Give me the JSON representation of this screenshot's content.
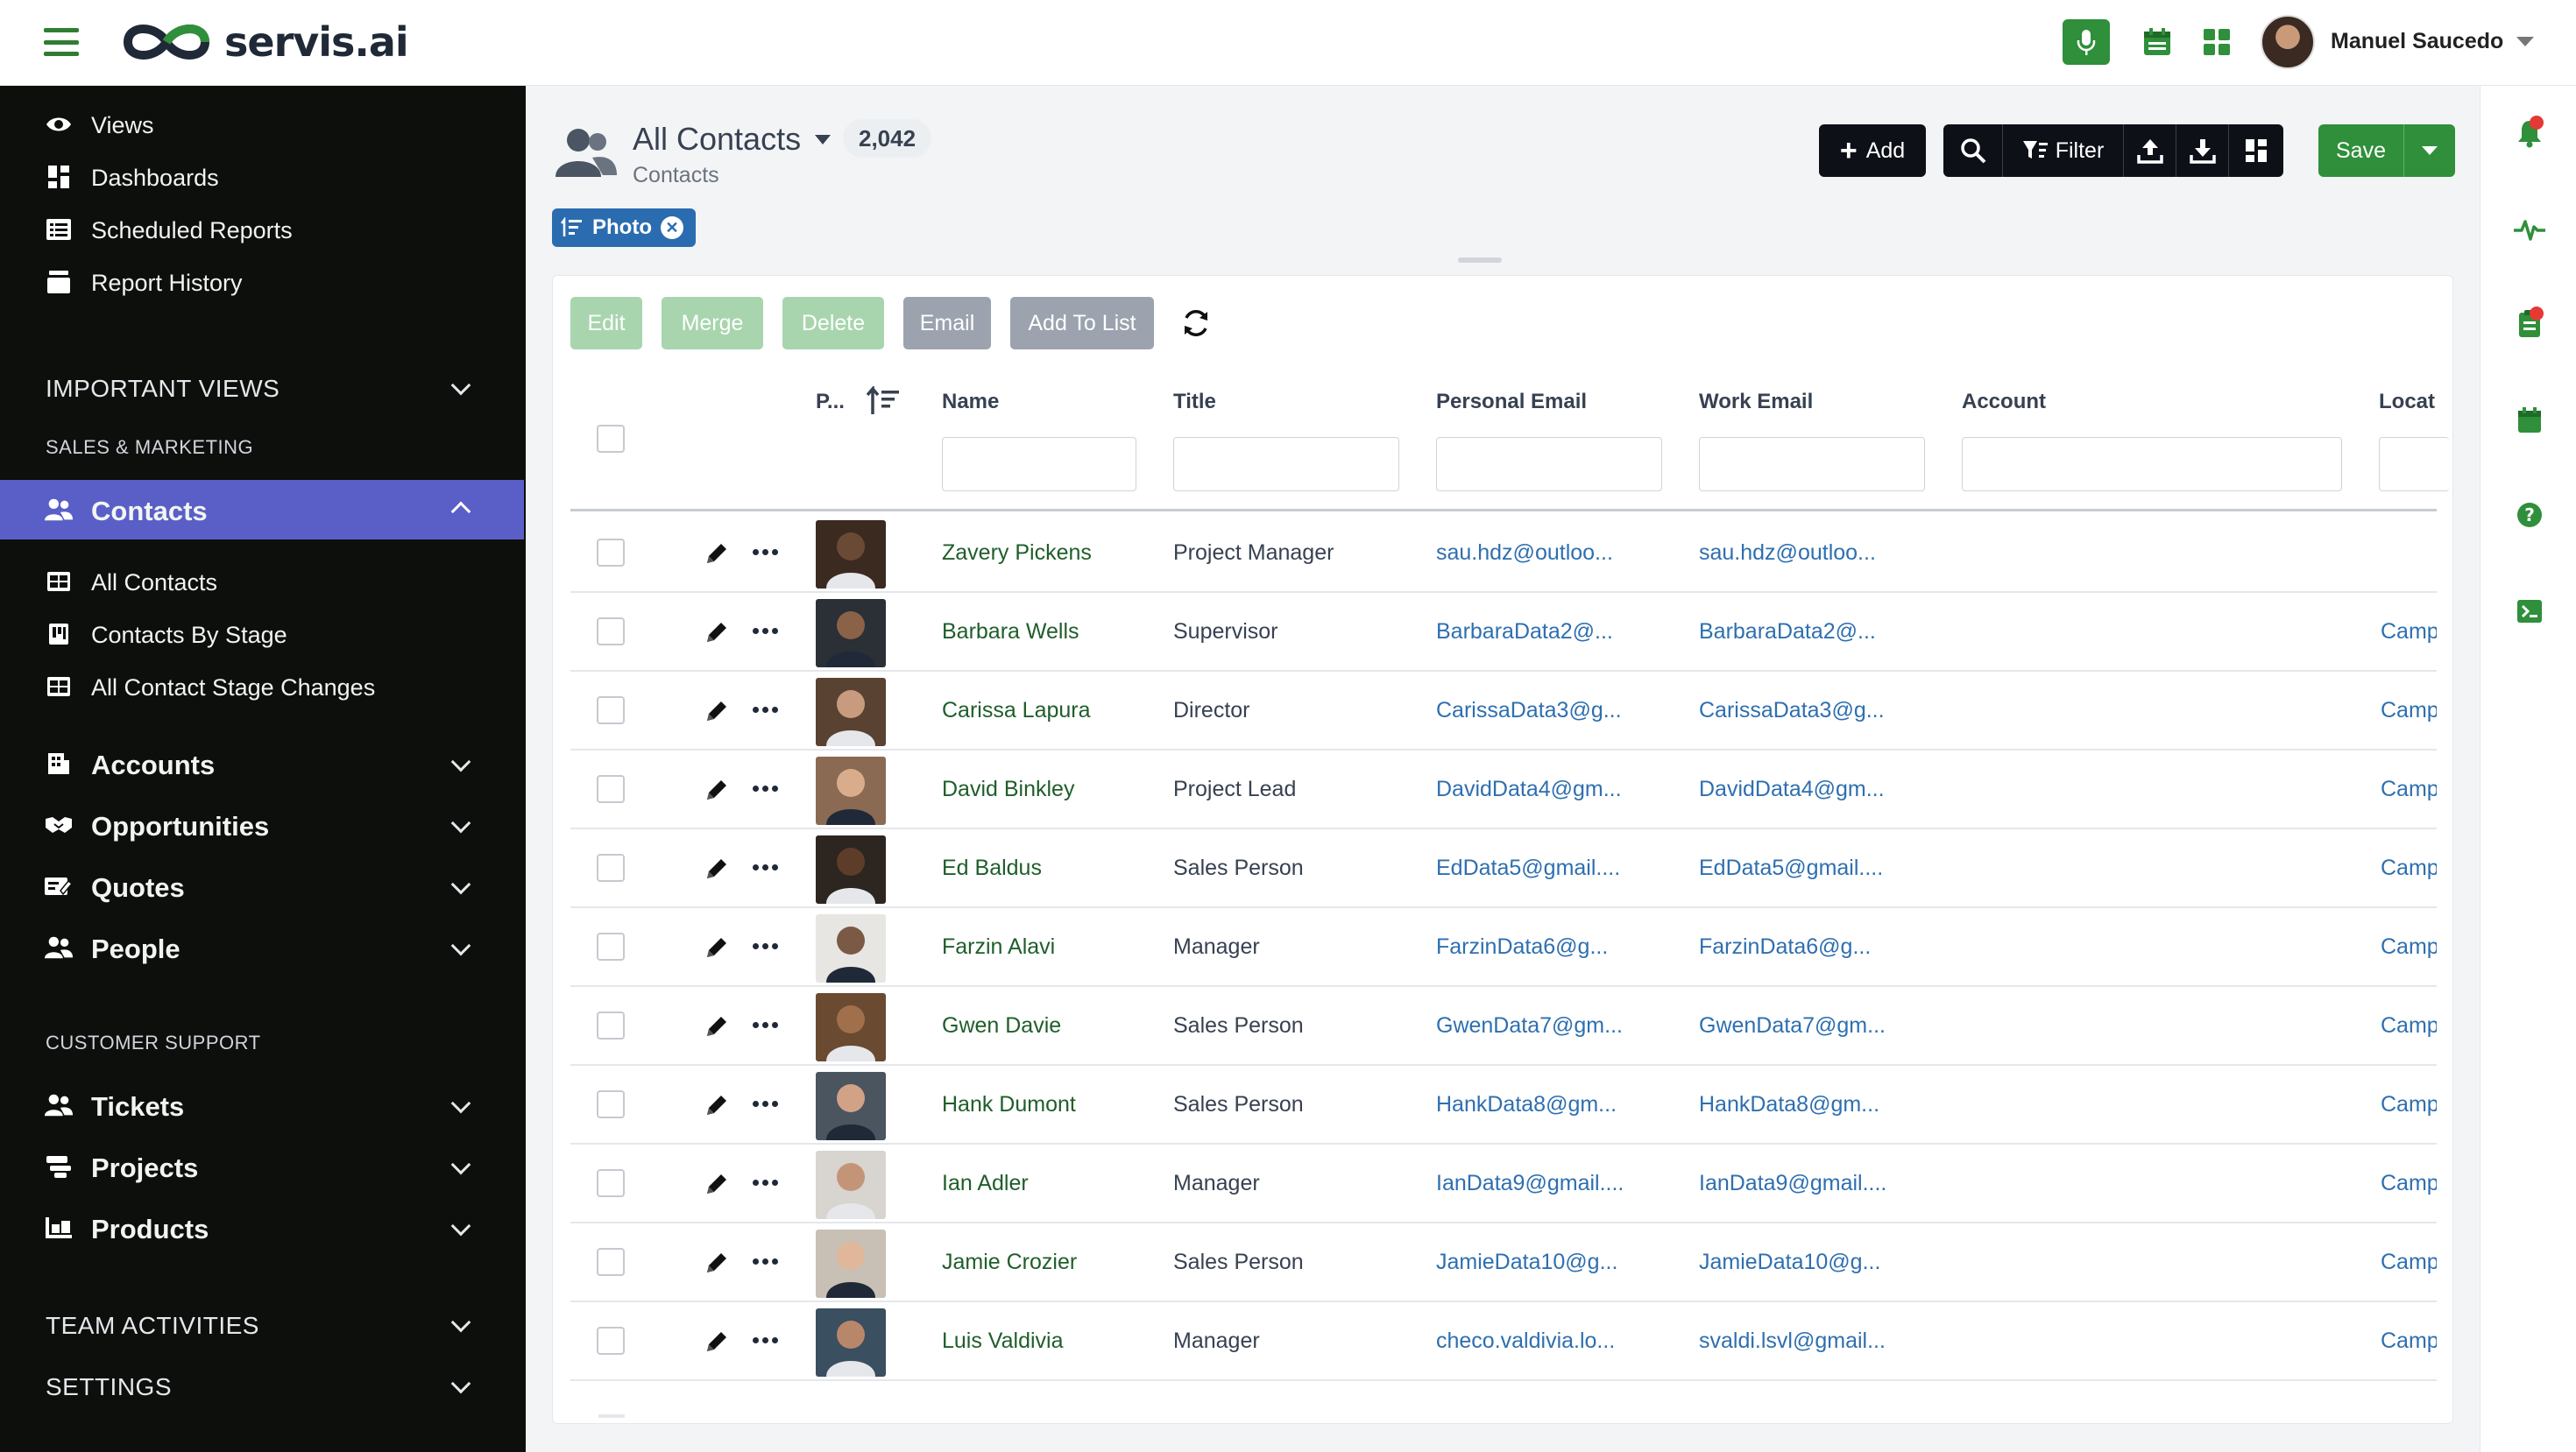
{
  "brand": {
    "name": "servis.ai"
  },
  "user": {
    "name": "Manuel Saucedo"
  },
  "sidebar": {
    "top_items": [
      {
        "label": "Views",
        "icon": "eye-icon"
      },
      {
        "label": "Dashboards",
        "icon": "dashboard-icon"
      },
      {
        "label": "Scheduled Reports",
        "icon": "report-list-icon"
      },
      {
        "label": "Report History",
        "icon": "archive-icon"
      }
    ],
    "important_views": "IMPORTANT VIEWS",
    "sales_marketing": "SALES & MARKETING",
    "contacts": "Contacts",
    "contacts_children": [
      "All Contacts",
      "Contacts By Stage",
      "All Contact Stage Changes"
    ],
    "sales_items": [
      "Accounts",
      "Opportunities",
      "Quotes",
      "People"
    ],
    "customer_support": "CUSTOMER SUPPORT",
    "support_items": [
      "Tickets",
      "Projects",
      "Products"
    ],
    "team_activities": "TEAM ACTIVITIES",
    "settings": "SETTINGS"
  },
  "header": {
    "title": "All Contacts",
    "count": "2,042",
    "subtitle": "Contacts",
    "chip": "Photo",
    "add_label": "Add",
    "filter_label": "Filter",
    "save_label": "Save"
  },
  "actions": [
    "Edit",
    "Merge",
    "Delete",
    "Email",
    "Add To List"
  ],
  "columns": {
    "photo": "P...",
    "name": "Name",
    "title": "Title",
    "personal_email": "Personal Email",
    "work_email": "Work Email",
    "account": "Account",
    "location": "Locat"
  },
  "rows": [
    {
      "name": "Zavery Pickens",
      "title": "Project Manager",
      "personal_email": "sau.hdz@outloo...",
      "work_email": "sau.hdz@outloo...",
      "account": "",
      "location": ""
    },
    {
      "name": "Barbara Wells",
      "title": "Supervisor",
      "personal_email": "BarbaraData2@...",
      "work_email": "BarbaraData2@...",
      "account": "",
      "location": "Camp"
    },
    {
      "name": "Carissa Lapura",
      "title": "Director",
      "personal_email": "CarissaData3@g...",
      "work_email": "CarissaData3@g...",
      "account": "",
      "location": "Camp"
    },
    {
      "name": "David Binkley",
      "title": "Project Lead",
      "personal_email": "DavidData4@gm...",
      "work_email": "DavidData4@gm...",
      "account": "",
      "location": "Camp"
    },
    {
      "name": "Ed Baldus",
      "title": "Sales Person",
      "personal_email": "EdData5@gmail....",
      "work_email": "EdData5@gmail....",
      "account": "",
      "location": "Camp"
    },
    {
      "name": "Farzin Alavi",
      "title": "Manager",
      "personal_email": "FarzinData6@g...",
      "work_email": "FarzinData6@g...",
      "account": "",
      "location": "Camp"
    },
    {
      "name": "Gwen Davie",
      "title": "Sales Person",
      "personal_email": "GwenData7@gm...",
      "work_email": "GwenData7@gm...",
      "account": "",
      "location": "Camp"
    },
    {
      "name": "Hank Dumont",
      "title": "Sales Person",
      "personal_email": "HankData8@gm...",
      "work_email": "HankData8@gm...",
      "account": "",
      "location": "Camp"
    },
    {
      "name": "Ian Adler",
      "title": "Manager",
      "personal_email": "IanData9@gmail....",
      "work_email": "IanData9@gmail....",
      "account": "",
      "location": "Camp"
    },
    {
      "name": "Jamie Crozier",
      "title": "Sales Person",
      "personal_email": "JamieData10@g...",
      "work_email": "JamieData10@g...",
      "account": "",
      "location": "Camp"
    },
    {
      "name": "Luis Valdivia",
      "title": "Manager",
      "personal_email": "checo.valdivia.lo...",
      "work_email": "svaldi.lsvl@gmail...",
      "account": "",
      "location": "Camp"
    }
  ],
  "colors": {
    "brand_green": "#2f8f3a",
    "sidebar_bg": "#0c0f0c",
    "active_nav": "#5a5fc8",
    "link_blue": "#2e6fb0",
    "name_green": "#1f5e2a",
    "chip_blue": "#2b6cb0"
  }
}
